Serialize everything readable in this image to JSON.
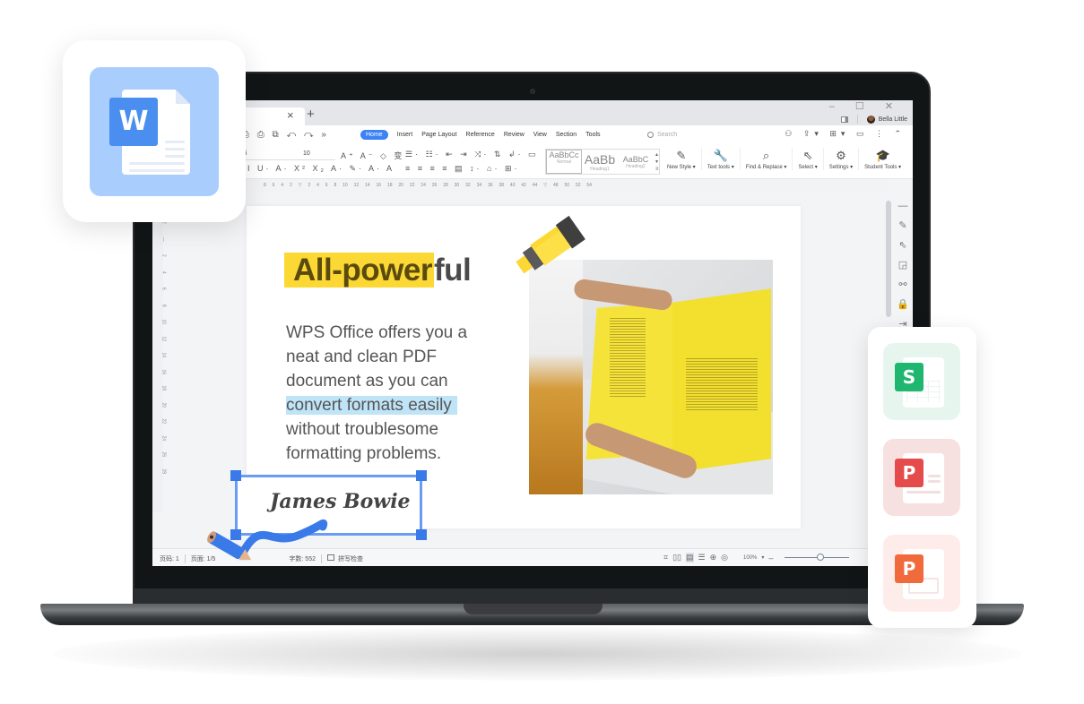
{
  "window": {
    "tab_close_glyph": "×",
    "tab_add_glyph": "+",
    "controls": "– ☐ ✕",
    "user_name": "Bella Little"
  },
  "menu": {
    "quick_access": "⎙ ⎙ ⧉ ↶ ↷ »",
    "items": [
      "Home",
      "Insert",
      "Page Layout",
      "Reference",
      "Review",
      "View",
      "Section",
      "Tools"
    ],
    "active": "Home",
    "search_placeholder": "Search",
    "right_icons": "⚇ ⇪▾ ⊞▾ ▭ ⋮ ⌃"
  },
  "ribbon": {
    "font_name": "ui",
    "font_size": "10",
    "format_row1": "A⁺ A⁻ ◇ 变·",
    "format_row2": "I U· A· X² X₂ A· ✎· A· A",
    "para_row1": "☰· ☷· ⇤ ⇥ ⤨· ⇅ ↲· ▭",
    "para_row2": "≡ ≡ ≡ ≡ ▤ ↕· ⌂· ⊞·",
    "styles": [
      {
        "preview": "AaBbCc",
        "name": "Normal"
      },
      {
        "preview": "AaBb",
        "name": "Heading1"
      },
      {
        "preview": "AaBbC",
        "name": "Heading2"
      }
    ],
    "tools": [
      {
        "icon": "✎",
        "label": "New Style ▾"
      },
      {
        "icon": "🔧",
        "label": "Text tools ▾"
      },
      {
        "icon": "⌕",
        "label": "Find & Replace ▾"
      },
      {
        "icon": "⇖",
        "label": "Select ▾"
      },
      {
        "icon": "⚙",
        "label": "Settings ▾"
      },
      {
        "icon": "🎓",
        "label": "Student Tools ▾"
      }
    ]
  },
  "ruler": {
    "h_ticks": [
      "8",
      "6",
      "4",
      "2",
      "",
      "2",
      "4",
      "6",
      "8",
      "10",
      "12",
      "14",
      "16",
      "18",
      "20",
      "22",
      "24",
      "26",
      "28",
      "30",
      "32",
      "34",
      "36",
      "38",
      "40",
      "42",
      "44",
      "",
      "48",
      "50",
      "52",
      "54"
    ],
    "v_ticks": [
      "6",
      "4",
      "2",
      "",
      "2",
      "4",
      "6",
      "8",
      "10",
      "12",
      "14",
      "16",
      "18",
      "20",
      "22",
      "24",
      "26",
      "28"
    ]
  },
  "document": {
    "headline_highlighted": "All-power",
    "headline_rest": "ful",
    "body_lines": [
      "WPS Office offers you a",
      "neat and clean PDF",
      "document as you can",
      "convert formats easily",
      "without troublesome",
      "formatting problems."
    ],
    "highlighted_line_index": 3,
    "signature": "James Bowie"
  },
  "right_sidebar_icons": [
    "—",
    "✎",
    "⇖",
    "◲",
    "⚯",
    "🔒",
    "⇥",
    "▭"
  ],
  "status": {
    "page_num": "页码: 1",
    "page_count": "页面: 1/5",
    "word_count": "字数: 552",
    "spell_check": "拼写检查",
    "view_icons": [
      "⌗",
      "▯▯",
      "▤",
      "☰",
      "⊕",
      "◎"
    ],
    "zoom_level": "100%",
    "zoom_fraction": 0.55
  },
  "apps": {
    "writer_letter": "W",
    "spreadsheet_letter": "S",
    "pdf_letter": "P",
    "presentation_letter": "P",
    "colors": {
      "writer": "#4a8ff0",
      "writer_tile": "#a9cdfd",
      "spreadsheet": "#1fb770",
      "spreadsheet_tile": "#e6f6ef",
      "pdf": "#e54b4b",
      "pdf_tile": "#f6e1e0",
      "presentation": "#f06a3b",
      "presentation_tile": "#fdecea",
      "highlight_yellow": "#fcd834",
      "selection_blue": "#bfe3f7",
      "accent": "#3b82f6"
    }
  }
}
